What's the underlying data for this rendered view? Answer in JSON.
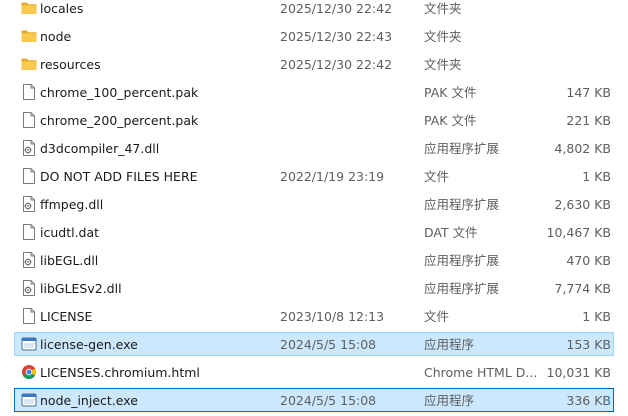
{
  "files": [
    {
      "name": "locales",
      "date": "2025/12/30 22:42",
      "type": "文件夹",
      "size": "",
      "icon": "folder-icon"
    },
    {
      "name": "node",
      "date": "2025/12/30 22:43",
      "type": "文件夹",
      "size": "",
      "icon": "folder-icon"
    },
    {
      "name": "resources",
      "date": "2025/12/30 22:42",
      "type": "文件夹",
      "size": "",
      "icon": "folder-icon"
    },
    {
      "name": "chrome_100_percent.pak",
      "date": "",
      "type": "PAK 文件",
      "size": "147 KB",
      "icon": "file-icon"
    },
    {
      "name": "chrome_200_percent.pak",
      "date": "",
      "type": "PAK 文件",
      "size": "221 KB",
      "icon": "file-icon"
    },
    {
      "name": "d3dcompiler_47.dll",
      "date": "",
      "type": "应用程序扩展",
      "size": "4,802 KB",
      "icon": "dll-file-icon"
    },
    {
      "name": "DO NOT ADD FILES HERE",
      "date": "2022/1/19 23:19",
      "type": "文件",
      "size": "1 KB",
      "icon": "file-icon"
    },
    {
      "name": "ffmpeg.dll",
      "date": "",
      "type": "应用程序扩展",
      "size": "2,630 KB",
      "icon": "dll-file-icon"
    },
    {
      "name": "icudtl.dat",
      "date": "",
      "type": "DAT 文件",
      "size": "10,467 KB",
      "icon": "file-icon"
    },
    {
      "name": "libEGL.dll",
      "date": "",
      "type": "应用程序扩展",
      "size": "470 KB",
      "icon": "dll-file-icon"
    },
    {
      "name": "libGLESv2.dll",
      "date": "",
      "type": "应用程序扩展",
      "size": "7,774 KB",
      "icon": "dll-file-icon"
    },
    {
      "name": "LICENSE",
      "date": "2023/10/8 12:13",
      "type": "文件",
      "size": "1 KB",
      "icon": "file-icon"
    },
    {
      "name": "license-gen.exe",
      "date": "2024/5/5 15:08",
      "type": "应用程序",
      "size": "153 KB",
      "icon": "exe-file-icon"
    },
    {
      "name": "LICENSES.chromium.html",
      "date": "",
      "type": "Chrome HTML D...",
      "size": "10,031 KB",
      "icon": "chrome-html-icon"
    },
    {
      "name": "node_inject.exe",
      "date": "2024/5/5 15:08",
      "type": "应用程序",
      "size": "336 KB",
      "icon": "exe-file-icon"
    }
  ],
  "selected": [
    "license-gen.exe",
    "node_inject.exe"
  ],
  "focused": "node_inject.exe",
  "colors": {
    "selection": "#cce8ff",
    "selection_border": "#99d1ff",
    "focus_border": "#0067c0",
    "folder": "#f8c94a"
  }
}
